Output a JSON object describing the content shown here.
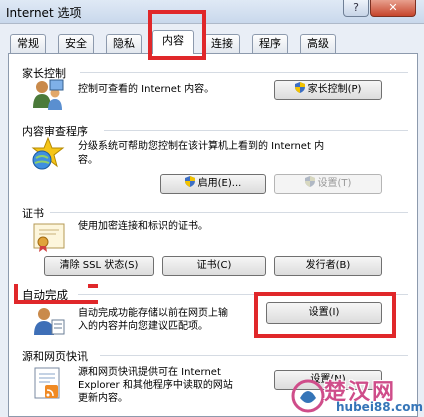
{
  "window": {
    "title": "Internet 选项",
    "help_glyph": "?",
    "close_glyph": "✕"
  },
  "tabs": [
    {
      "label": "常规"
    },
    {
      "label": "安全"
    },
    {
      "label": "隐私"
    },
    {
      "label": "内容",
      "active": true
    },
    {
      "label": "连接"
    },
    {
      "label": "程序"
    },
    {
      "label": "高级"
    }
  ],
  "parental_controls": {
    "title": "家长控制",
    "description": "控制可查看的 Internet 内容。",
    "button_label": "家长控制(P)",
    "icon": "parental-controls-icon"
  },
  "content_advisor": {
    "title": "内容审查程序",
    "description_line1": "分级系统可帮助您控制在该计算机上看到的 Internet 内",
    "description_line2": "容。",
    "enable_label": "启用(E)...",
    "settings_label": "设置(T)",
    "icon": "content-advisor-icon"
  },
  "certificates": {
    "title": "证书",
    "description": "使用加密连接和标识的证书。",
    "clear_ssl_label": "清除 SSL 状态(S)",
    "certificates_label": "证书(C)",
    "publishers_label": "发行者(B)",
    "icon": "certificate-icon"
  },
  "autocomplete": {
    "title": "自动完成",
    "description_line1": "自动完成功能存储以前在网页上输",
    "description_line2": "入的内容并向您建议匹配项。",
    "settings_label": "设置(I)",
    "icon": "autocomplete-icon"
  },
  "feeds": {
    "title": "源和网页快讯",
    "description_line1": "源和网页快讯提供可在 Internet",
    "description_line2": "Explorer 和其他程序中读取的网站",
    "description_line3": "更新内容。",
    "settings_label": "设置(N)",
    "icon": "feeds-icon"
  },
  "watermark": {
    "text": "楚汉网",
    "url": "hubei88.com"
  },
  "colors": {
    "highlight": "#e0272a",
    "window_bg": "#e9eef6",
    "panel_bg": "#ffffff"
  }
}
